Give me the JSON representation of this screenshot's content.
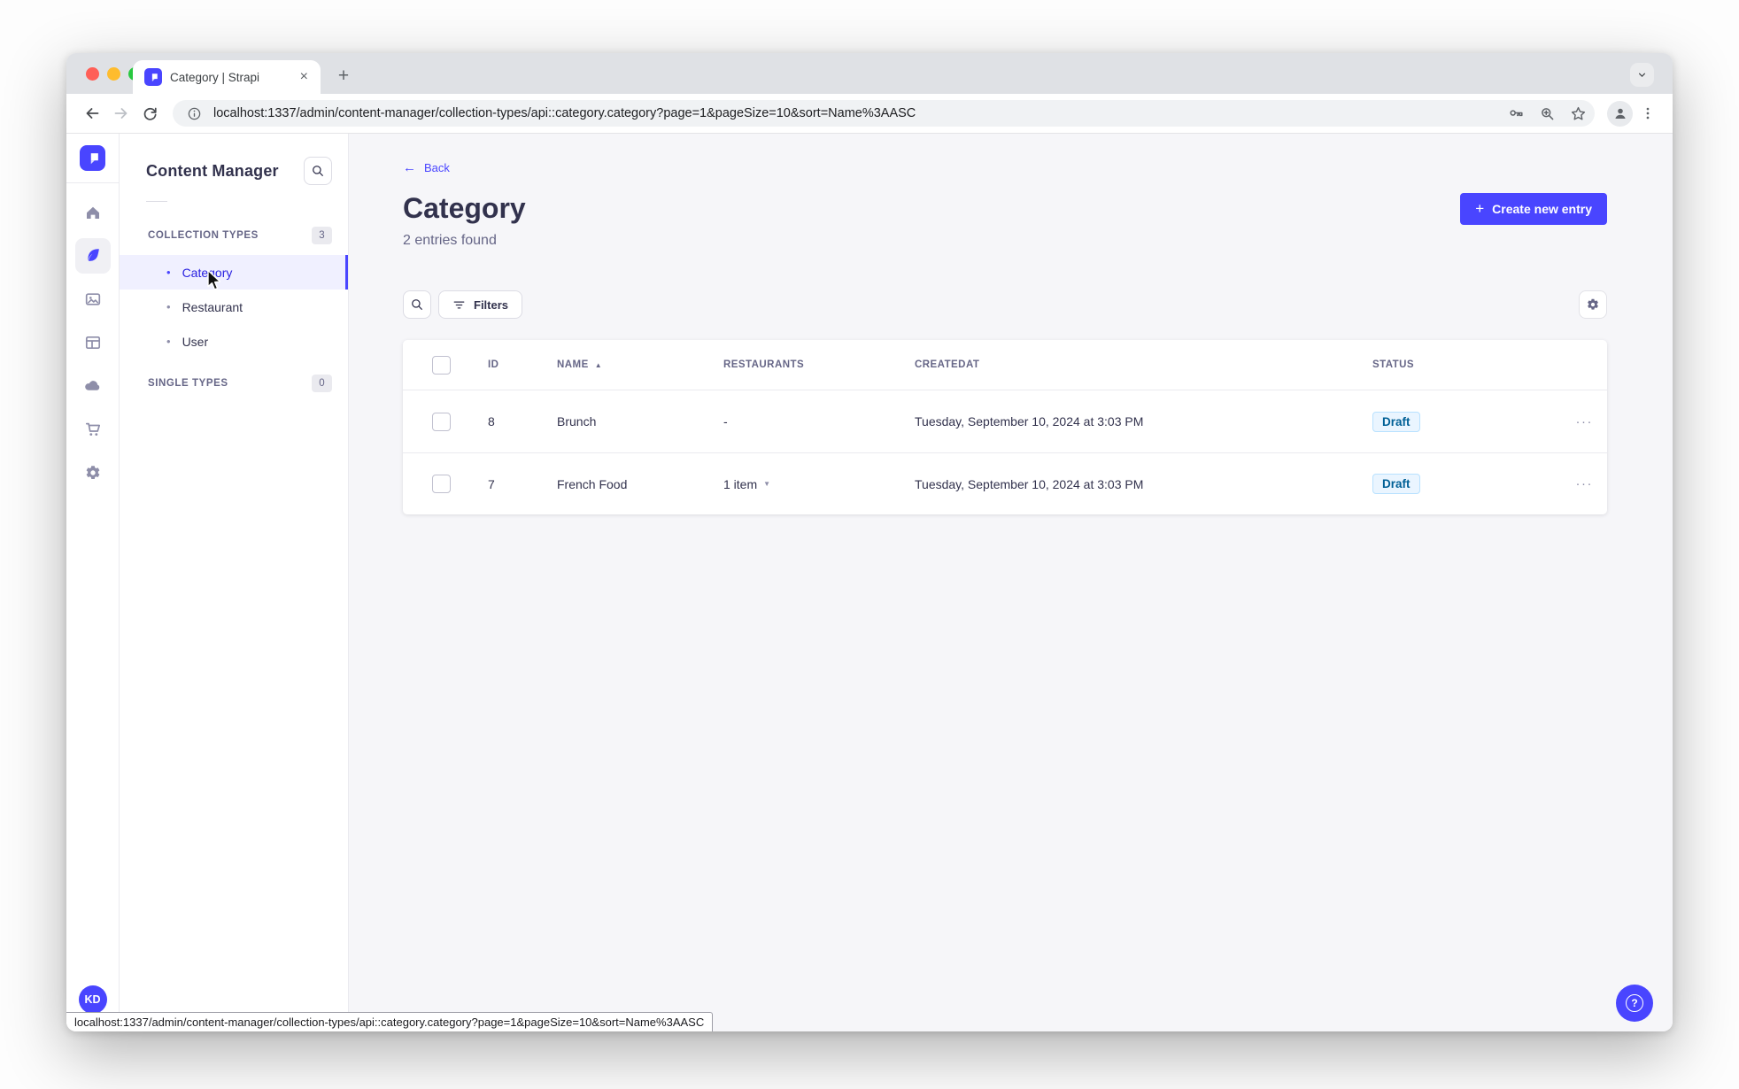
{
  "browser": {
    "tab_title": "Category | Strapi",
    "close_tab_glyph": "×",
    "new_tab_glyph": "+",
    "url": "localhost:1337/admin/content-manager/collection-types/api::category.category?page=1&pageSize=10&sort=Name%3AASC",
    "status_url": "localhost:1337/admin/content-manager/collection-types/api::category.category?page=1&pageSize=10&sort=Name%3AASC"
  },
  "nav": {
    "title": "Content Manager",
    "bullet": "•",
    "collection_section": {
      "label": "COLLECTION TYPES",
      "count": "3"
    },
    "items": [
      {
        "label": "Category",
        "selected": true
      },
      {
        "label": "Restaurant",
        "selected": false
      },
      {
        "label": "User",
        "selected": false
      }
    ],
    "single_section": {
      "label": "SINGLE TYPES",
      "count": "0"
    }
  },
  "header": {
    "back_arrow": "←",
    "back": "Back",
    "title": "Category",
    "subtitle": "2 entries found",
    "plus": "+",
    "create": "Create new entry"
  },
  "toolbar": {
    "filters": "Filters"
  },
  "table": {
    "columns": {
      "id": "ID",
      "name": "NAME",
      "restaurants": "RESTAURANTS",
      "createdat": "CREATEDAT",
      "status": "STATUS"
    },
    "sort_glyph": "▲",
    "caret_glyph": "▼",
    "actions_glyph": "···",
    "rows": [
      {
        "id": "8",
        "name": "Brunch",
        "restaurants": "-",
        "createdat": "Tuesday, September 10, 2024 at 3:03 PM",
        "status": "Draft"
      },
      {
        "id": "7",
        "name": "French Food",
        "restaurants": "1 item",
        "createdat": "Tuesday, September 10, 2024 at 3:03 PM",
        "status": "Draft"
      }
    ]
  },
  "user": {
    "initials": "KD"
  },
  "help": {
    "glyph": "?"
  },
  "colors": {
    "accent": "#4945ff",
    "selected_bg": "#f0f0ff",
    "draft_bg": "#eaf5ff",
    "draft_border": "#b8e1ff",
    "draft_text": "#006096",
    "main_bg": "#f6f6f9"
  }
}
